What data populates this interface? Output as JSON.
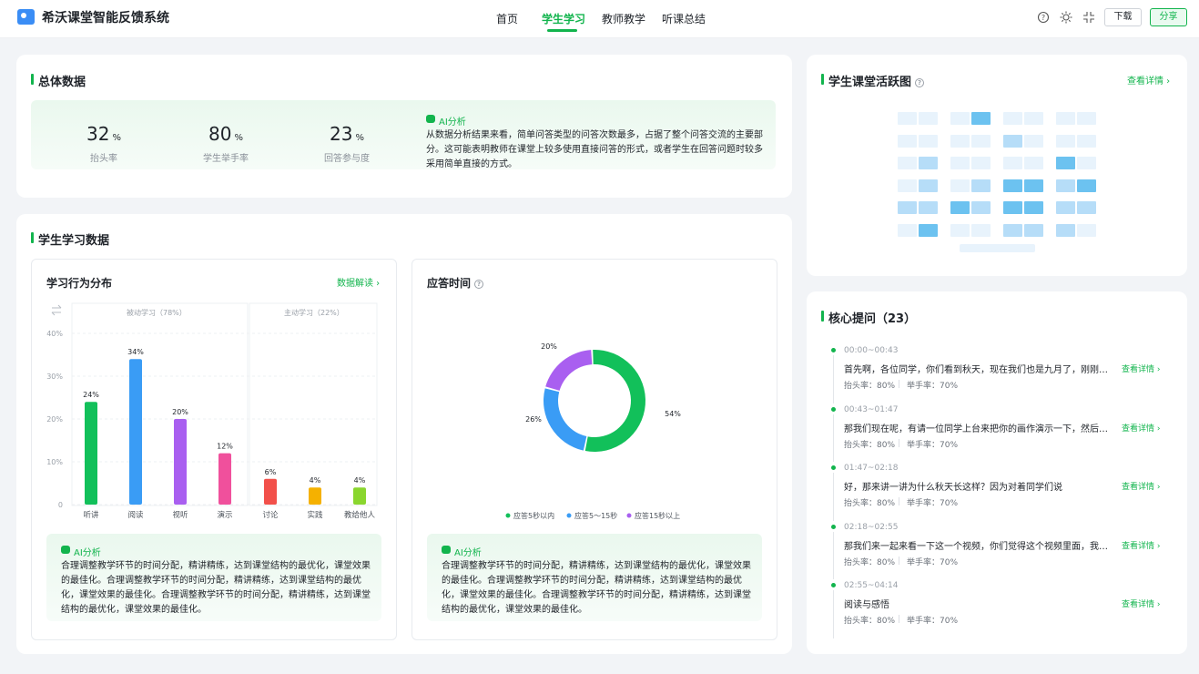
{
  "app": {
    "title": "希沃课堂智能反馈系统"
  },
  "nav": [
    {
      "label": "首页"
    },
    {
      "label": "学生学习"
    },
    {
      "label": "教师教学"
    },
    {
      "label": "听课总结"
    }
  ],
  "header_actions": {
    "download": "下载",
    "share": "分享",
    "icons": [
      "help-icon",
      "brightness-icon",
      "collapse-icon"
    ]
  },
  "overview": {
    "title": "总体数据",
    "metrics": [
      {
        "value": "32",
        "unit": "%",
        "label": "抬头率"
      },
      {
        "value": "80",
        "unit": "%",
        "label": "学生举手率"
      },
      {
        "value": "23",
        "unit": "%",
        "label": "回答参与度"
      }
    ],
    "ai_label": "AI分析",
    "ai_text": "从数据分析结果来看，简单问答类型的问答次数最多，占据了整个问答交流的主要部分。这可能表明教师在课堂上较多使用直接问答的形式，或者学生在回答问题时较多采用简单直接的方式。"
  },
  "learning": {
    "title": "学生学习数据",
    "behavior": {
      "title": "学习行为分布",
      "link": "数据解读 ›",
      "group_passive": "被动学习（78%）",
      "group_active": "主动学习（22%）",
      "ai_label": "AI分析",
      "ai_text": "合理调整教学环节的时间分配，精讲精练，达到课堂结构的最优化，课堂效果的最佳化。合理调整教学环节的时间分配，精讲精练，达到课堂结构的最优化，课堂效果的最佳化。合理调整教学环节的时间分配，精讲精练，达到课堂结构的最优化，课堂效果的最佳化。"
    },
    "response": {
      "title": "应答时间",
      "ai_label": "AI分析",
      "ai_text": "合理调整教学环节的时间分配，精讲精练，达到课堂结构的最优化，课堂效果的最佳化。合理调整教学环节的时间分配，精讲精练，达到课堂结构的最优化，课堂效果的最佳化。合理调整教学环节的时间分配，精讲精练，达到课堂结构的最优化，课堂效果的最佳化。"
    }
  },
  "chart_data": [
    {
      "type": "bar",
      "title": "学习行为分布",
      "categories": [
        "听讲",
        "阅读",
        "视听",
        "演示",
        "讨论",
        "实践",
        "教给他人"
      ],
      "values": [
        24,
        34,
        20,
        12,
        6,
        4,
        4
      ],
      "value_labels": [
        "24%",
        "34%",
        "20%",
        "12%",
        "6%",
        "4%",
        "4%"
      ],
      "colors": [
        "#12c05a",
        "#3a9cf5",
        "#a95ff0",
        "#f0509c",
        "#f2504a",
        "#f5b100",
        "#8ad62e"
      ],
      "yticks": [
        "0",
        "10%",
        "20%",
        "30%",
        "40%"
      ],
      "ylim": [
        0,
        40
      ],
      "grid": true
    },
    {
      "type": "pie",
      "title": "应答时间",
      "labels": [
        "应答5秒以内",
        "应答5～15秒",
        "应答15秒以上"
      ],
      "values": [
        54,
        26,
        20
      ],
      "value_labels": [
        "54%",
        "26%",
        "20%"
      ],
      "colors": [
        "#12c05a",
        "#3a9cf5",
        "#a95ff0"
      ],
      "legend": "bottom"
    }
  ],
  "activity": {
    "title": "学生课堂活跃图",
    "link": "查看详情 ›",
    "levels": [
      [
        1,
        1,
        1,
        3,
        1,
        1,
        1,
        1
      ],
      [
        1,
        1,
        1,
        1,
        2,
        1,
        1,
        1
      ],
      [
        1,
        2,
        1,
        1,
        1,
        1,
        3,
        1
      ],
      [
        1,
        2,
        1,
        2,
        3,
        3,
        2,
        3
      ],
      [
        2,
        2,
        3,
        2,
        3,
        3,
        2,
        2
      ],
      [
        1,
        3,
        1,
        1,
        2,
        2,
        2,
        1
      ]
    ],
    "colors": [
      "#e8f3fc",
      "#b6ddf8",
      "#6cc2f0"
    ]
  },
  "core_questions": {
    "title": "核心提问（23）",
    "items": [
      {
        "time": "00:00~00:43",
        "text": "首先啊，各位同学，你们看到秋天，现在我们也是九月了，刚刚过...",
        "head_rate": "抬头率：80%",
        "hand_rate": "举手率：70%",
        "link": "查看详情 ›"
      },
      {
        "time": "00:43~01:47",
        "text": "那我们现在呢，有请一位同学上台来把你的画作演示一下，然后呢...",
        "head_rate": "抬头率：80%",
        "hand_rate": "举手率：70%",
        "link": "查看详情 ›"
      },
      {
        "time": "01:47~02:18",
        "text": "好，那来讲一讲为什么秋天长这样？因为对着同学们说",
        "head_rate": "抬头率：80%",
        "hand_rate": "举手率：70%",
        "link": "查看详情 ›"
      },
      {
        "time": "02:18~02:55",
        "text": "那我们来一起来看一下这一个视频，你们觉得这个视频里面，我们...",
        "head_rate": "抬头率：80%",
        "hand_rate": "举手率：70%",
        "link": "查看详情 ›"
      },
      {
        "time": "02:55~04:14",
        "text": "阅读与感悟",
        "head_rate": "抬头率：80%",
        "hand_rate": "举手率：70%",
        "link": "查看详情 ›"
      }
    ]
  }
}
